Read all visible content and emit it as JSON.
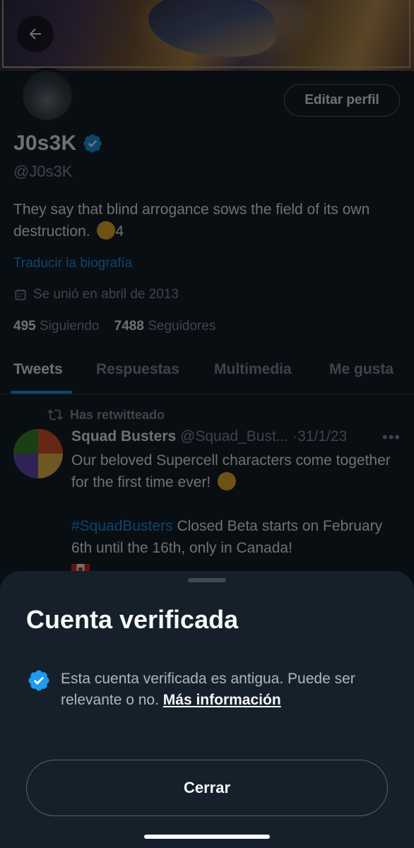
{
  "profile": {
    "back_icon": "arrow-left-icon",
    "edit_button": "Editar perfil",
    "name": "J0s3K",
    "handle": "@J0s3K",
    "bio_text": "They say that blind arrogance sows the field of its own destruction.",
    "bio_emoji": "pensive-face-emoji",
    "bio_suffix": "4",
    "translate_link": "Traducir la biografía",
    "joined_icon": "calendar-icon",
    "joined": "Se unió en abril de 2013",
    "following_count": "495",
    "following_label": "Siguiendo",
    "followers_count": "7488",
    "followers_label": "Seguidores"
  },
  "tabs": [
    {
      "label": "Tweets",
      "active": true
    },
    {
      "label": "Respuestas",
      "active": false
    },
    {
      "label": "Multimedia",
      "active": false
    },
    {
      "label": "Me gusta",
      "active": false
    }
  ],
  "tweet": {
    "retweet_label": "Has retwitteado",
    "author": "Squad Busters",
    "handle": "@Squad_Bust...",
    "date": "31/1/23",
    "more_label": "•••",
    "line1": "Our beloved Supercell characters come together for the first time ever!",
    "line1_emoji": "partying-face-emoji",
    "hashtag": "#SquadBusters",
    "line2": "Closed Beta starts on February 6th until the 16th, only in Canada!",
    "flag_emoji": "canada-flag-emoji"
  },
  "sheet": {
    "title": "Cuenta verificada",
    "text": "Esta cuenta verificada es antigua. Puede ser relevante o no.",
    "link": "Más información",
    "close_button": "Cerrar"
  },
  "colors": {
    "background": "#15202b",
    "accent": "#1d9bf0",
    "text_secondary": "#8b98a5"
  }
}
